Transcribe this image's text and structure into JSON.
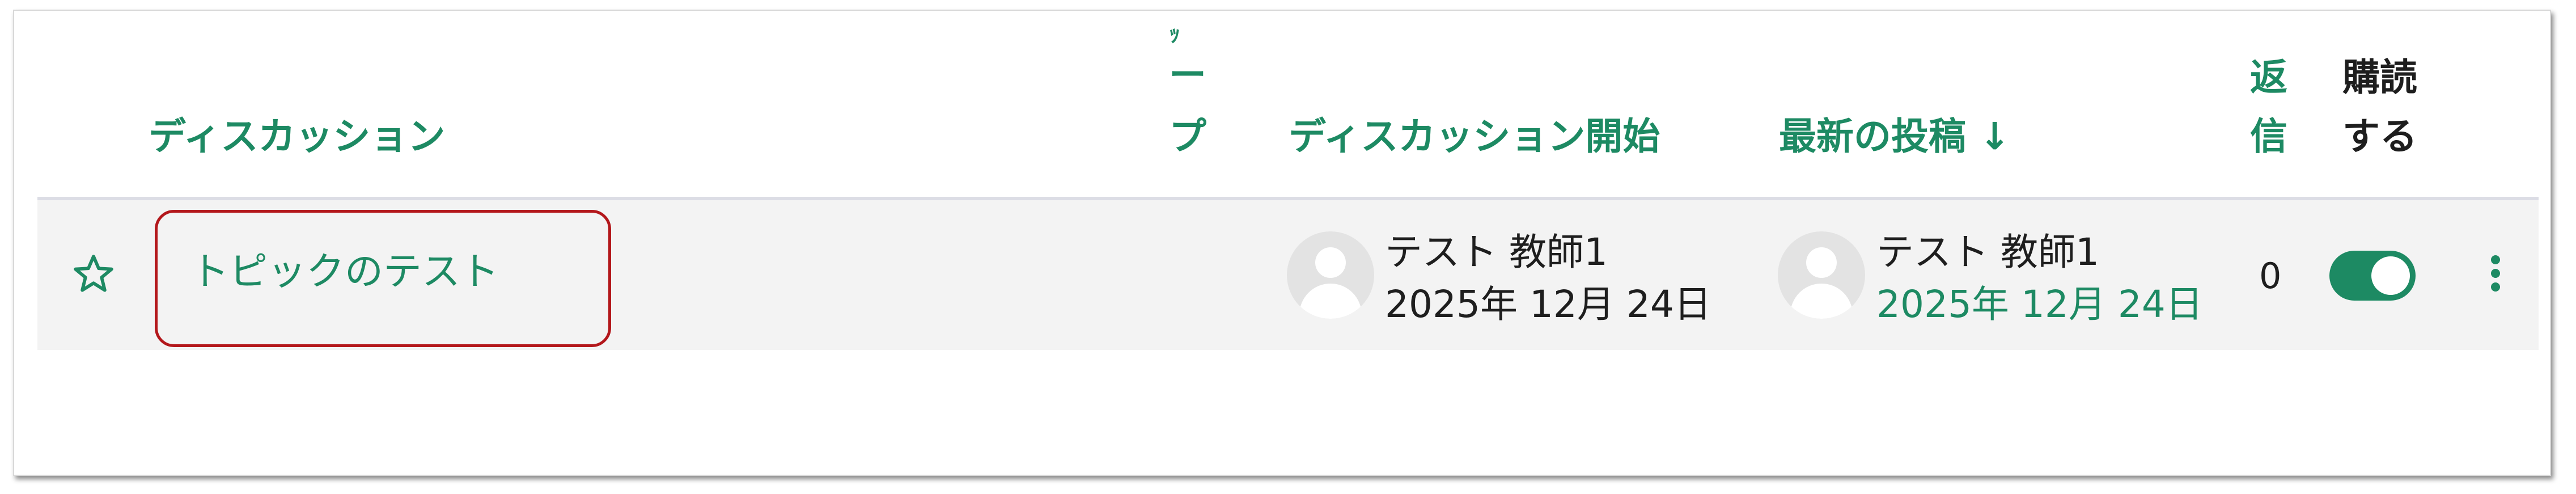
{
  "table": {
    "headers": {
      "discussion": "ディスカッション",
      "group_fragment_1": "ー",
      "group_fragment_2": "プ",
      "started_by": "ディスカッション開始",
      "last_post": "最新の投稿 ↓",
      "replies_1": "返",
      "replies_2": "信",
      "subscribe_1": "購読",
      "subscribe_2": "する"
    },
    "rows": [
      {
        "topic": "トピックのテスト",
        "started_by_name": "テスト 教師1",
        "started_date": "2025年 12月 24日",
        "last_post_name": "テスト 教師1",
        "last_post_date": "2025年 12月 24日",
        "replies": "0",
        "subscribed": true
      }
    ]
  },
  "colors": {
    "accent": "#1d8a63",
    "highlight_border": "#b3171b",
    "row_background": "#f3f3f3"
  },
  "icons": [
    "star-icon",
    "avatar-icon",
    "toggle-switch",
    "kebab-menu-icon"
  ]
}
